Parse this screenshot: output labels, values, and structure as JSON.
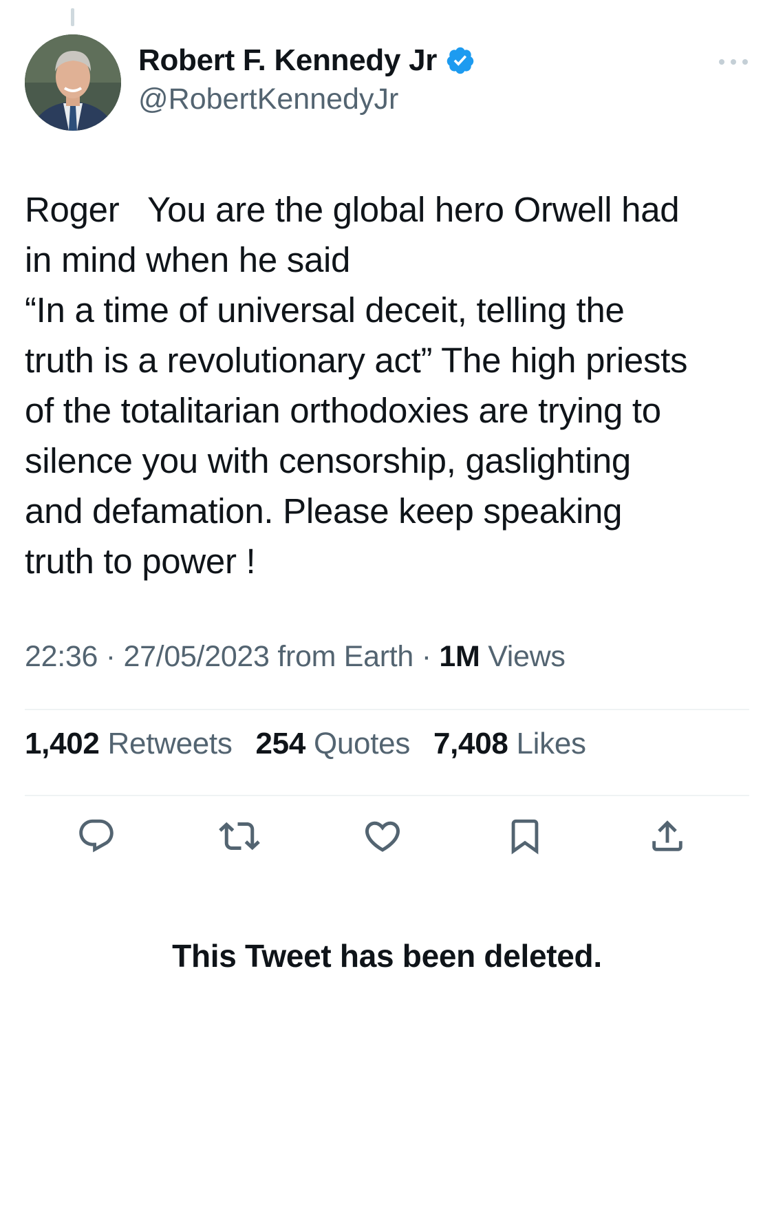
{
  "author": {
    "display_name": "Robert F. Kennedy Jr",
    "handle": "@RobertKennedyJr",
    "verified": true,
    "verified_color": "#1d9bf0"
  },
  "tweet": {
    "text": "Roger   You are the global hero Orwell had\nin mind when he said\n“In a time of universal deceit, telling the\ntruth is a revolutionary act” The high priests\nof the totalitarian orthodoxies are trying to\nsilence you with censorship, gaslighting\nand defamation. Please keep speaking\ntruth to power !",
    "time": "22:36",
    "date": "27/05/2023",
    "source": "from Earth",
    "views_count": "1M",
    "views_label": "Views",
    "separator": "·"
  },
  "stats": {
    "retweets_count": "1,402",
    "retweets_label": "Retweets",
    "quotes_count": "254",
    "quotes_label": "Quotes",
    "likes_count": "7,408",
    "likes_label": "Likes"
  },
  "actions": [
    {
      "icon": "reply-icon"
    },
    {
      "icon": "retweet-icon"
    },
    {
      "icon": "like-icon"
    },
    {
      "icon": "bookmark-icon"
    },
    {
      "icon": "share-icon"
    }
  ],
  "status_message": "This Tweet has been deleted.",
  "colors": {
    "text_primary": "#0f1419",
    "text_secondary": "#536471",
    "icon": "#536471",
    "divider": "#eff3f4"
  }
}
